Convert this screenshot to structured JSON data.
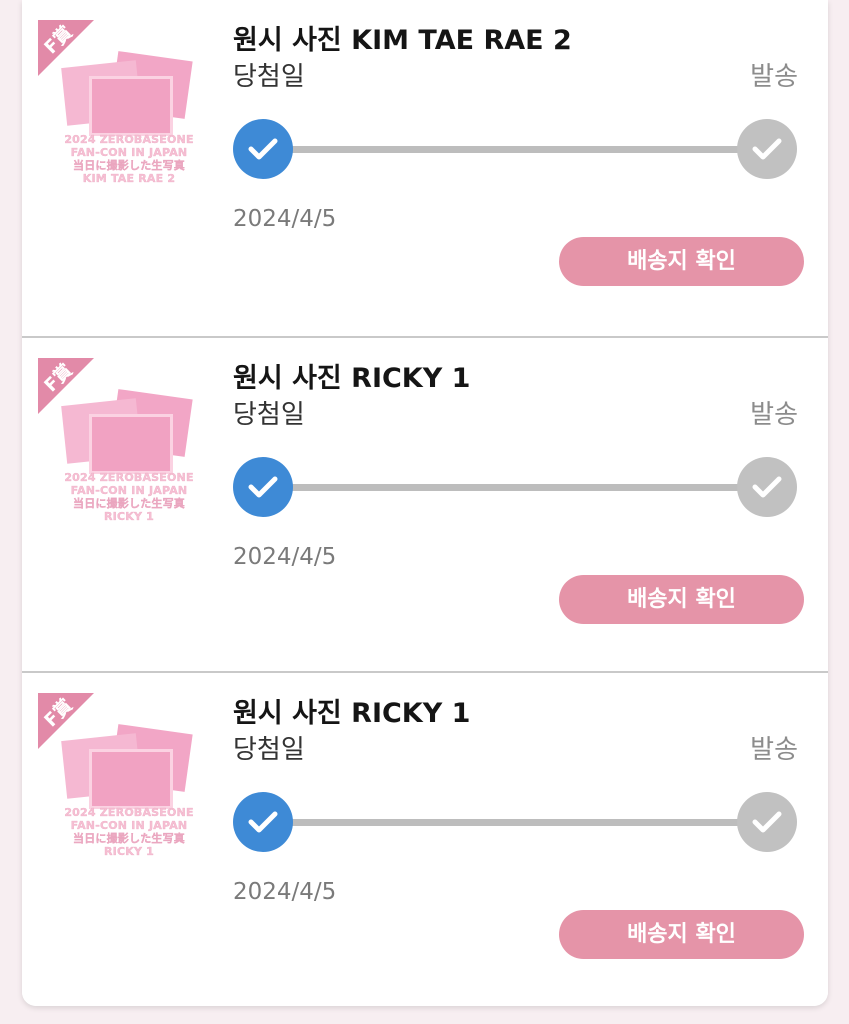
{
  "colors": {
    "accent_pink": "#e594a8",
    "progress_done": "#3e8ad6",
    "progress_pending": "#c1c1c1"
  },
  "items": [
    {
      "title": "원시 사진 KIM TAE RAE 2",
      "step_start": "당첨일",
      "step_end": "발송",
      "progress": 0,
      "date": "2024/4/5",
      "button_label": "배송지 확인",
      "thumb": {
        "ribbon_text": "F賞",
        "caption_line1": "2024 ZEROBASEONE",
        "caption_line2": "FAN-CON IN JAPAN",
        "caption_line3": "当日に撮影した生写真",
        "caption_line4": "KIM TAE RAE 2"
      }
    },
    {
      "title": "원시 사진 RICKY 1",
      "step_start": "당첨일",
      "step_end": "발송",
      "progress": 0,
      "date": "2024/4/5",
      "button_label": "배송지 확인",
      "thumb": {
        "ribbon_text": "F賞",
        "caption_line1": "2024 ZEROBASEONE",
        "caption_line2": "FAN-CON IN JAPAN",
        "caption_line3": "当日に撮影した生写真",
        "caption_line4": "RICKY 1"
      }
    },
    {
      "title": "원시 사진 RICKY 1",
      "step_start": "당첨일",
      "step_end": "발송",
      "progress": 0,
      "date": "2024/4/5",
      "button_label": "배송지 확인",
      "thumb": {
        "ribbon_text": "F賞",
        "caption_line1": "2024 ZEROBASEONE",
        "caption_line2": "FAN-CON IN JAPAN",
        "caption_line3": "当日に撮影した生写真",
        "caption_line4": "RICKY 1"
      }
    }
  ]
}
